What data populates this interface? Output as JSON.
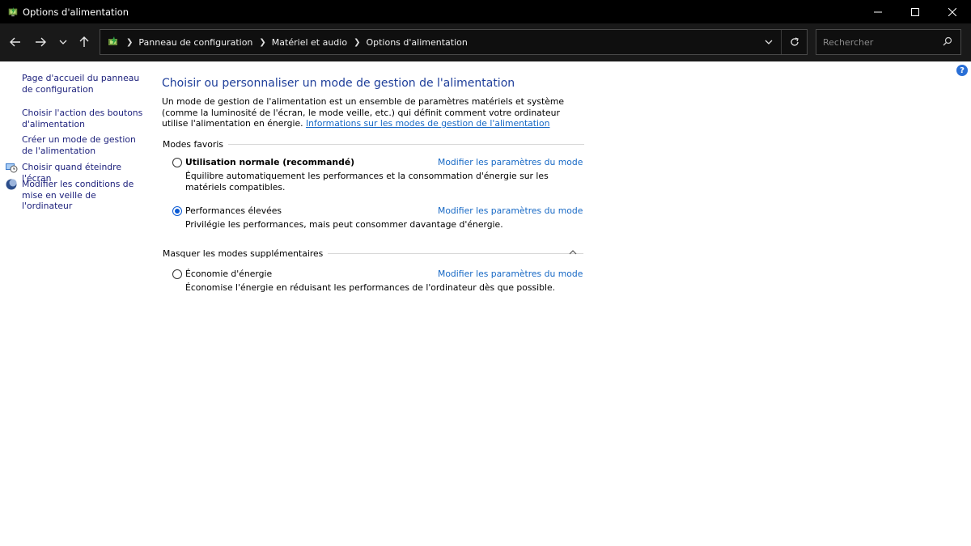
{
  "window": {
    "title": "Options d'alimentation"
  },
  "nav": {
    "breadcrumbs": [
      "Panneau de configuration",
      "Matériel et audio",
      "Options d'alimentation"
    ],
    "search_placeholder": "Rechercher"
  },
  "left_pane": {
    "links": [
      "Page d'accueil du panneau de configuration",
      "Choisir l'action des boutons d'alimentation",
      "Créer un mode de gestion de l'alimentation",
      "Choisir quand éteindre l'écran",
      "Modifier les conditions de mise en veille de l'ordinateur"
    ]
  },
  "main": {
    "title": "Choisir ou personnaliser un mode de gestion de l'alimentation",
    "intro_text": "Un mode de gestion de l'alimentation est un ensemble de paramètres matériels et système (comme la luminosité de l'écran, le mode veille, etc.) qui définit comment votre ordinateur utilise l'alimentation en énergie.",
    "intro_link": "Informations sur les modes de gestion de l'alimentation",
    "favorites_header": "Modes favoris",
    "extra_header": "Masquer les modes supplémentaires",
    "plans": [
      {
        "name": "Utilisation normale (recommandé)",
        "desc": "Équilibre automatiquement les performances et la consommation d'énergie sur les matériels compatibles.",
        "link": "Modifier les paramètres du mode",
        "selected": false
      },
      {
        "name": "Performances élevées",
        "desc": "Privilégie les performances, mais peut consommer davantage d'énergie.",
        "link": "Modifier les paramètres du mode",
        "selected": true
      },
      {
        "name": "Économie d'énergie",
        "desc": "Économise l'énergie en réduisant les performances de l'ordinateur dès que possible.",
        "link": "Modifier les paramètres du mode",
        "selected": false
      }
    ]
  },
  "colors": {
    "link": "#1668c5",
    "title": "#1e3e9a",
    "left_link": "#1a1e7a",
    "radio_selected": "#0a5ad4"
  }
}
